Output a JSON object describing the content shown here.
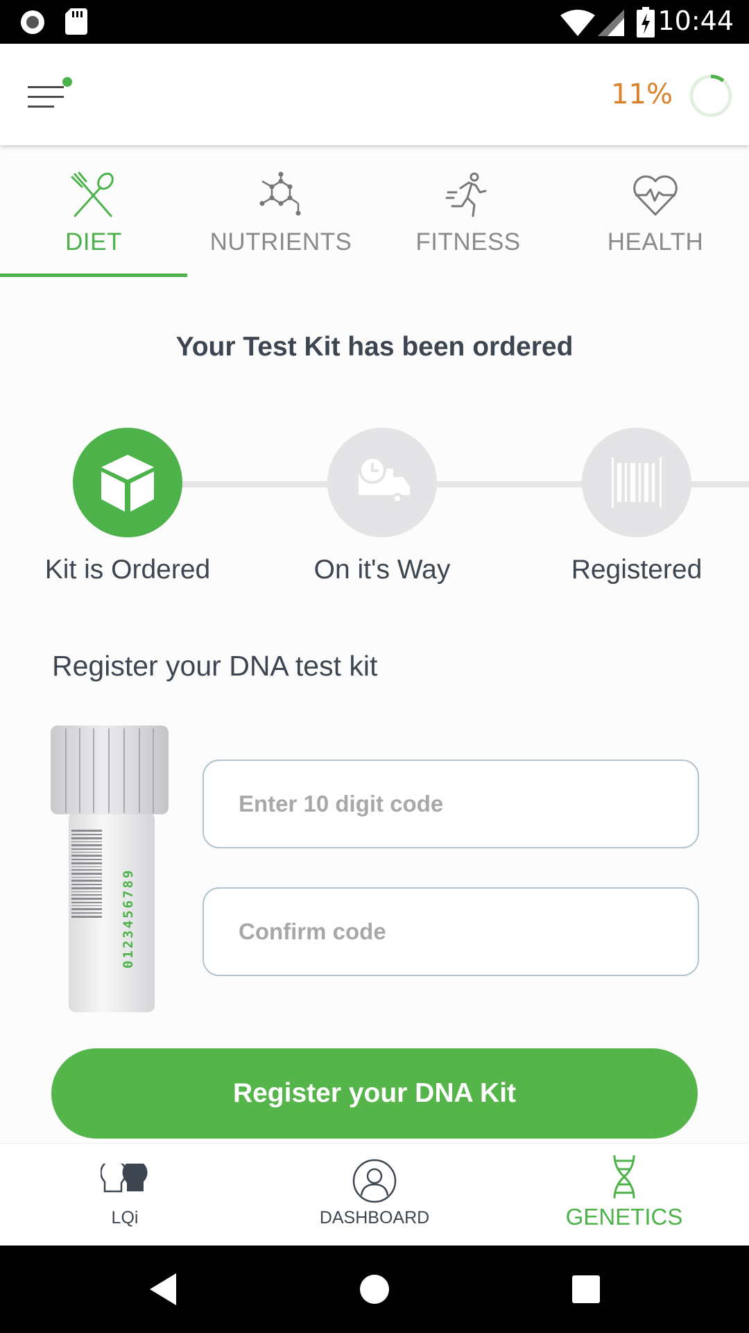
{
  "status_bar": {
    "time": "10:44"
  },
  "header": {
    "progress_text": "11%",
    "progress_value": 0.11
  },
  "tabs": [
    {
      "label": "DIET",
      "icon": "fork-spoon-icon",
      "active": true
    },
    {
      "label": "NUTRIENTS",
      "icon": "molecule-icon",
      "active": false
    },
    {
      "label": "FITNESS",
      "icon": "runner-icon",
      "active": false
    },
    {
      "label": "HEALTH",
      "icon": "heart-pulse-icon",
      "active": false
    }
  ],
  "main": {
    "heading": "Your Test Kit has been ordered",
    "steps": [
      {
        "label": "Kit is Ordered",
        "icon": "box-icon",
        "active": true
      },
      {
        "label": "On it's Way",
        "icon": "delivery-truck-icon",
        "active": false
      },
      {
        "label": "Registered",
        "icon": "barcode-icon",
        "active": false
      }
    ],
    "register_title": "Register your DNA test kit",
    "tube_code": "0123456789",
    "code_input": {
      "placeholder": "Enter 10 digit code",
      "value": ""
    },
    "confirm_input": {
      "placeholder": "Confirm code",
      "value": ""
    },
    "register_button": "Register your DNA Kit"
  },
  "bottom_nav": [
    {
      "label": "LQi",
      "icon": "heads-icon",
      "active": false
    },
    {
      "label": "DASHBOARD",
      "icon": "profile-icon",
      "active": false
    },
    {
      "label": "GENETICS",
      "icon": "dna-icon",
      "active": true
    }
  ],
  "colors": {
    "accent": "#4db24a",
    "progress": "#d9822b",
    "text": "#3d4650",
    "inactive": "#8a8a8a"
  }
}
